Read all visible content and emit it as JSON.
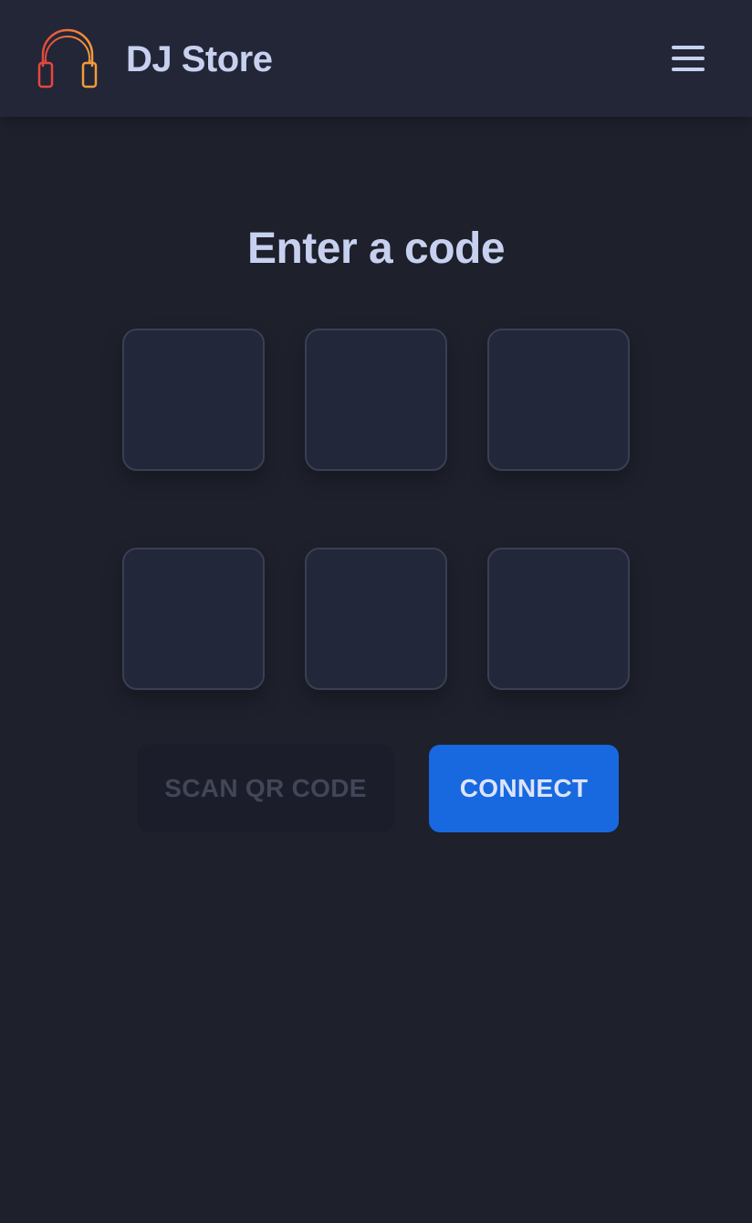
{
  "header": {
    "brand": "DJ Store",
    "logo_icon": "headphones-icon",
    "menu_icon": "hamburger-menu-icon",
    "logo_gradient": [
      "#e5483c",
      "#f59a3c"
    ]
  },
  "main": {
    "title": "Enter a code",
    "code_digits": [
      "",
      "",
      "",
      "",
      "",
      ""
    ],
    "scan_label": "SCAN QR CODE",
    "connect_label": "CONNECT"
  },
  "colors": {
    "background": "#1e202c",
    "header": "#222636",
    "text": "#c7d1ef",
    "accent": "#1868e0"
  }
}
